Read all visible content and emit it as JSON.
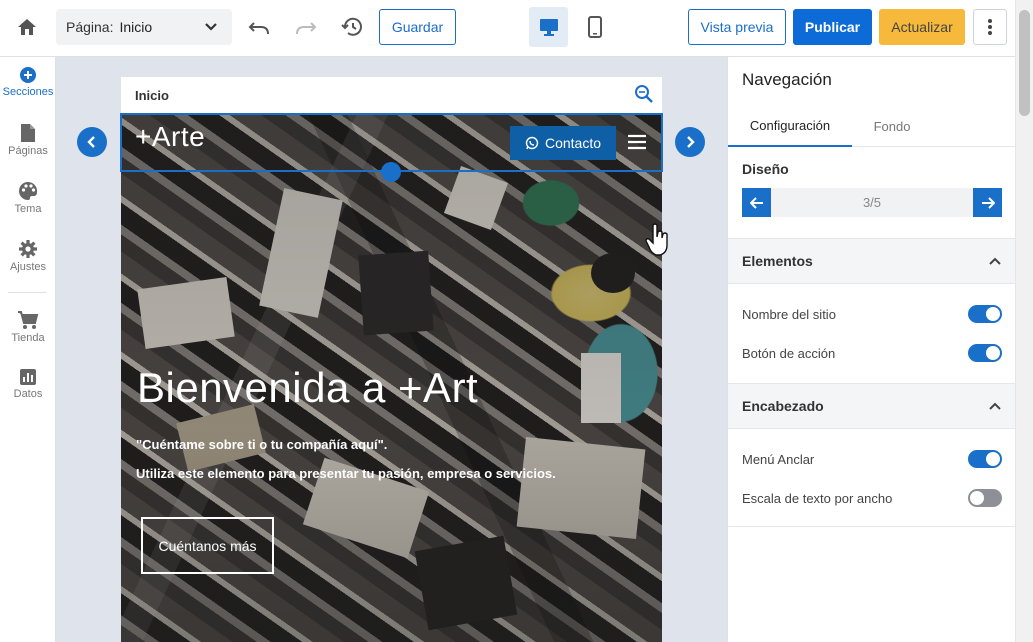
{
  "toolbar": {
    "page_label": "Página:",
    "page_value": "Inicio",
    "save_label": "Guardar",
    "preview_label": "Vista previa",
    "publish_label": "Publicar",
    "update_label": "Actualizar"
  },
  "sidebar": {
    "items": [
      {
        "label": "Secciones",
        "icon": "plus-circle-icon",
        "active": true
      },
      {
        "label": "Páginas",
        "icon": "page-icon"
      },
      {
        "label": "Tema",
        "icon": "palette-icon"
      },
      {
        "label": "Ajustes",
        "icon": "gear-icon"
      },
      {
        "label": "Tienda",
        "icon": "cart-icon"
      },
      {
        "label": "Datos",
        "icon": "chart-icon"
      }
    ]
  },
  "site": {
    "url_label": "Inicio",
    "logo": "+Arte",
    "contact_label": "Contacto",
    "hero_title": "Bienvenida a +Art",
    "hero_sub1": "\"Cuéntame sobre ti o tu compañía aquí\".",
    "hero_sub2": "Utiliza este elemento para presentar tu pasión, empresa o servicios.",
    "hero_cta": "Cuéntanos más"
  },
  "panel": {
    "title": "Navegación",
    "tabs": [
      "Configuración",
      "Fondo"
    ],
    "design_label": "Diseño",
    "design_count": "3/5",
    "sections": [
      {
        "title": "Elementos",
        "options": [
          {
            "label": "Nombre del sitio",
            "enabled": true
          },
          {
            "label": "Botón de acción",
            "enabled": true
          }
        ]
      },
      {
        "title": "Encabezado",
        "options": [
          {
            "label": "Menú Anclar",
            "enabled": true
          },
          {
            "label": "Escala de texto por ancho",
            "enabled": false
          }
        ]
      }
    ]
  },
  "colors": {
    "accent": "#1a6fc9",
    "publish": "#0c6bd6",
    "update": "#f6b93b"
  }
}
